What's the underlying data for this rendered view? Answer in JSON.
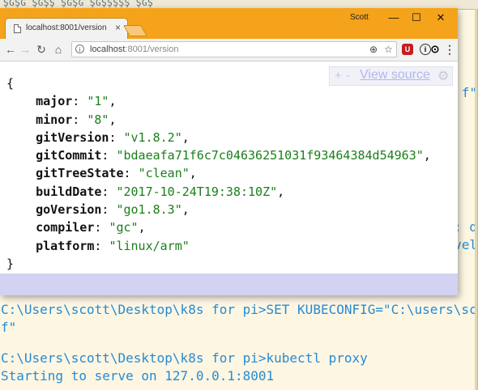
{
  "terminal": {
    "top_fragment": "ŞĞŞĞ ŞĞŞŞ ŞĞŞĞ ŞĞŞŞŞŞŞ ŞĞŞ",
    "right_fragments": [
      "f\"",
      ": d",
      "vel"
    ],
    "lines": [
      "C:\\Users\\scott\\Desktop\\k8s for pi>SET KUBECONFIG=\"C:\\users\\scot",
      "f\"",
      "",
      "C:\\Users\\scott\\Desktop\\k8s for pi>kubectl proxy",
      "Starting to serve on 127.0.0.1:8001"
    ]
  },
  "browser": {
    "profile_name": "Scott",
    "tab_title": "localhost:8001/version",
    "tab_close": "×",
    "url_host": "localhost",
    "url_path": ":8001/version",
    "window_buttons": {
      "minimize": "—",
      "maximize": "☐",
      "close": "✕"
    },
    "nav": {
      "back": "←",
      "forward": "→",
      "reload": "↻",
      "home": "⌂"
    },
    "omnibox_icons": {
      "zoom": "⊕",
      "star": "☆"
    },
    "extensions": [
      {
        "name": "ublock",
        "label": "U",
        "color": "#c41e1e"
      },
      {
        "name": "info",
        "label": "i",
        "color": "#333333"
      },
      {
        "name": "circle",
        "label": "⊙",
        "color": "#333333"
      },
      {
        "name": "menu",
        "label": "⋮",
        "color": "#555555"
      }
    ],
    "json_view": {
      "open_brace": "{",
      "close_brace": "}",
      "fields": [
        {
          "key": "major",
          "value": "\"1\""
        },
        {
          "key": "minor",
          "value": "\"8\""
        },
        {
          "key": "gitVersion",
          "value": "\"v1.8.2\""
        },
        {
          "key": "gitCommit",
          "value": "\"bdaeafa71f6c7c04636251031f93464384d54963\""
        },
        {
          "key": "gitTreeState",
          "value": "\"clean\""
        },
        {
          "key": "buildDate",
          "value": "\"2017-10-24T19:38:10Z\""
        },
        {
          "key": "goVersion",
          "value": "\"go1.8.3\""
        },
        {
          "key": "compiler",
          "value": "\"gc\""
        },
        {
          "key": "platform",
          "value": "\"linux/arm\""
        }
      ]
    },
    "view_source": {
      "plus": "+",
      "minus": "-",
      "link": "View source",
      "gear": "⚙"
    }
  }
}
